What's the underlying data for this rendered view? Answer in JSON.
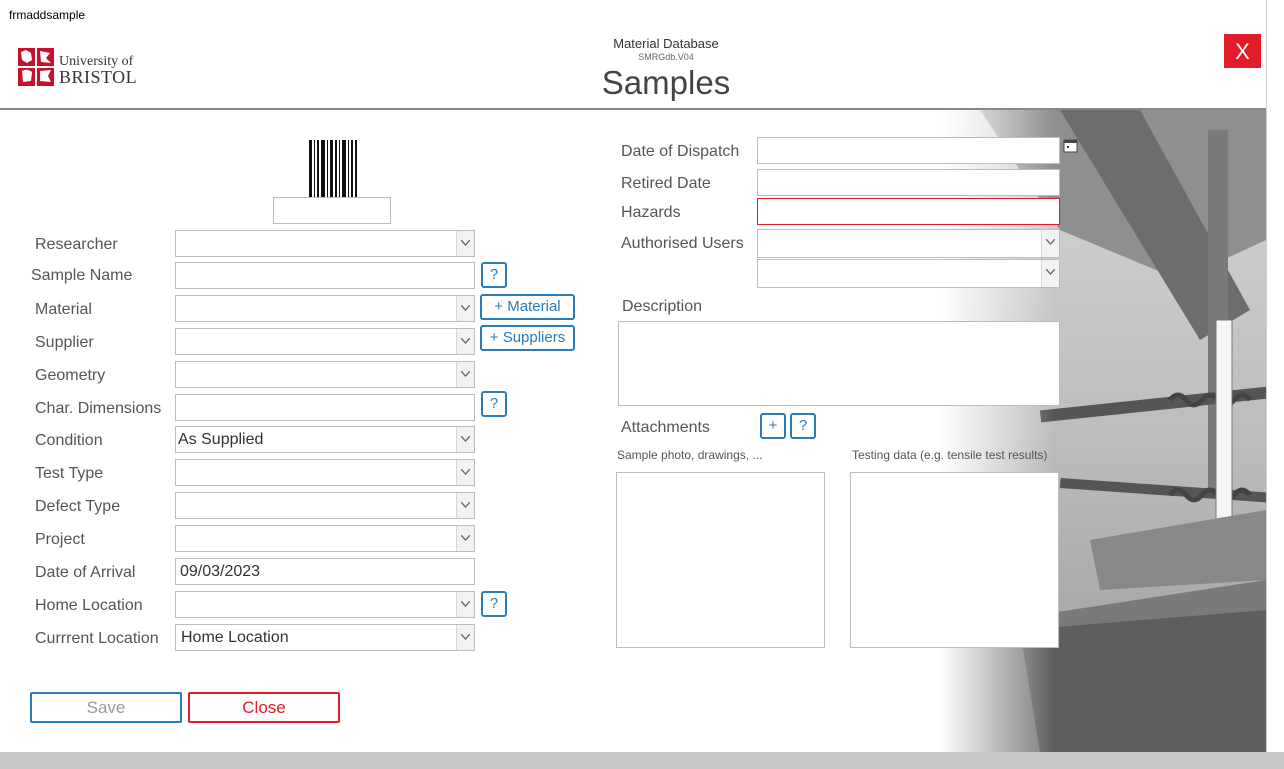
{
  "window": {
    "title": "frmaddsample"
  },
  "header": {
    "logo_line1": "University of",
    "logo_line2": "BRISTOL",
    "app_name": "Material Database",
    "app_version": "SMRGdb.V04",
    "page_title": "Samples",
    "close_label": "X"
  },
  "form": {
    "researcher": {
      "label": "Researcher",
      "value": ""
    },
    "sample_name": {
      "label": "Sample Name",
      "value": "",
      "help": "?"
    },
    "material": {
      "label": "Material",
      "value": "",
      "add": "+ Material"
    },
    "supplier": {
      "label": "Supplier",
      "value": "",
      "add": "+ Suppliers"
    },
    "geometry": {
      "label": "Geometry",
      "value": ""
    },
    "char_dimensions": {
      "label": "Char. Dimensions",
      "value": "",
      "help": "?"
    },
    "condition": {
      "label": "Condition",
      "value": "As Supplied"
    },
    "test_type": {
      "label": "Test Type",
      "value": ""
    },
    "defect_type": {
      "label": "Defect Type",
      "value": ""
    },
    "project": {
      "label": "Project",
      "value": ""
    },
    "date_of_arrival": {
      "label": "Date of Arrival",
      "value": "09/03/2023"
    },
    "home_location": {
      "label": "Home Location",
      "value": "",
      "help": "?"
    },
    "current_location": {
      "label": "Currrent Location",
      "value": "Home Location"
    }
  },
  "right": {
    "date_of_dispatch": {
      "label": "Date of Dispatch",
      "value": ""
    },
    "retired_date": {
      "label": "Retired Date",
      "value": ""
    },
    "hazards": {
      "label": "Hazards",
      "value": ""
    },
    "authorised_users": {
      "label": "Authorised Users",
      "value1": "",
      "value2": ""
    },
    "description": {
      "label": "Description",
      "value": ""
    },
    "attachments": {
      "label": "Attachments",
      "add": "+",
      "help": "?",
      "photos_label": "Sample photo, drawings, ...",
      "testing_label": "Testing data (e.g. tensile test results)"
    }
  },
  "buttons": {
    "save": "Save",
    "close": "Close"
  },
  "colors": {
    "accent": "#2b7bb9",
    "danger": "#e01d28",
    "bottom_bar": "#c6c7c9"
  }
}
